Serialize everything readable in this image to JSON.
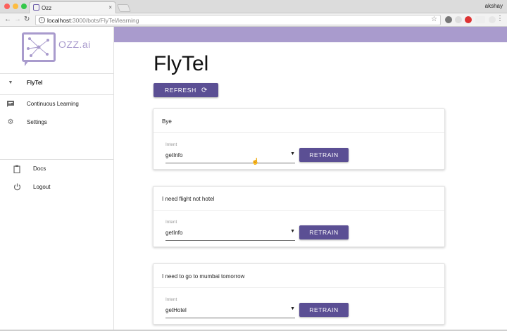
{
  "browser": {
    "tab_title": "Ozz",
    "tab_close": "×",
    "user": "akshay",
    "url_host": "localhost",
    "url_path": ":3000/bots/FlyTel/learning",
    "star": "☆",
    "menu": "⋮"
  },
  "sidebar": {
    "logo_text": "OZZ.ai",
    "bot_name": "FlyTel",
    "items": [
      {
        "label": "Continuous Learning",
        "icon": "feedback-icon"
      },
      {
        "label": "Settings",
        "icon": "gear-icon"
      },
      {
        "label": "Docs",
        "icon": "clipboard-icon"
      },
      {
        "label": "Logout",
        "icon": "power-icon"
      }
    ]
  },
  "main": {
    "title": "FlyTel",
    "refresh_label": "REFRESH",
    "cards": [
      {
        "text": "Bye",
        "intent_label": "Intent",
        "intent_value": "getInfo",
        "retrain_label": "RETRAIN"
      },
      {
        "text": "I need flight not hotel",
        "intent_label": "Intent",
        "intent_value": "getInfo",
        "retrain_label": "RETRAIN"
      },
      {
        "text": "I need to go to mumbai tomorrow",
        "intent_label": "Intent",
        "intent_value": "getHotel",
        "retrain_label": "RETRAIN"
      }
    ]
  },
  "colors": {
    "accent": "#5b4f94",
    "header": "#a99bcd"
  }
}
